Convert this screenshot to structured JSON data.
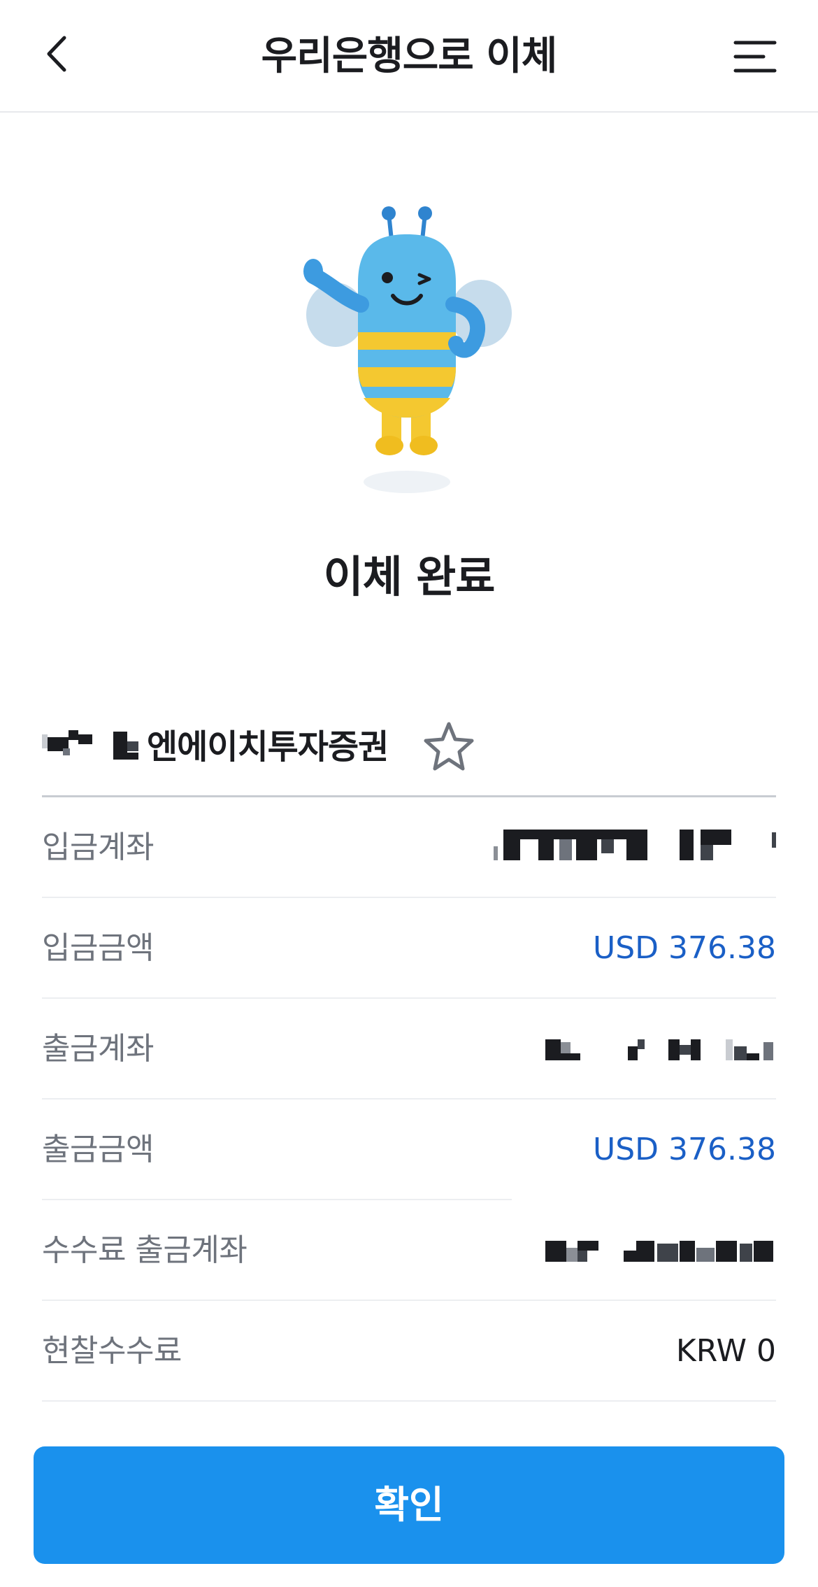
{
  "header": {
    "title": "우리은행으로 이체",
    "back_icon": "chevron-left-icon",
    "menu_icon": "hamburger-menu-icon"
  },
  "mascot": {
    "icon": "bee-mascot-icon"
  },
  "result": {
    "title": "이체 완료"
  },
  "recipient": {
    "name": "엔에이치투자증권",
    "favorite_icon": "star-outline-icon"
  },
  "details": [
    {
      "label": "입금계좌",
      "value": ""
    },
    {
      "label": "입금금액",
      "value": "USD 376.38"
    },
    {
      "label": "출금계좌",
      "value": ""
    },
    {
      "label": "출금금액",
      "value": "USD 376.38"
    },
    {
      "label": "수수료 출금계좌",
      "value": ""
    },
    {
      "label": "현찰수수료",
      "value": "KRW 0"
    }
  ],
  "actions": {
    "confirm_label": "확인"
  },
  "colors": {
    "primary": "#1a91ed",
    "amount": "#1a5fc6",
    "label": "#6e737c",
    "text": "#1b1c20"
  }
}
